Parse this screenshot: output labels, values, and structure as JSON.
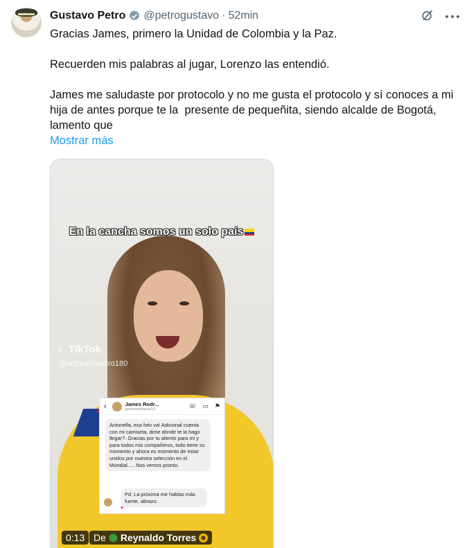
{
  "tweet": {
    "author_name": "Gustavo Petro",
    "handle": "@petrogustavo",
    "separator": "·",
    "time": "52min",
    "paragraphs": [
      "Gracias James, primero la Unidad de Colombia y la Paz.",
      "Recuerden mis palabras al jugar, Lorenzo las entendió.",
      "James me saludaste por protocolo y no me gusta el protocolo y sí conoces a mi hija de antes porque te la  presente de pequeñita, siendo alcalde de Bogotá, lamento que"
    ],
    "show_more": "Mostrar más"
  },
  "media": {
    "caption": "En la cancha somos un solo país",
    "watermark": "TikTok",
    "watermark_handle": "@antonellapetro180",
    "chat": {
      "name": "James Rodr...",
      "username": "jamesrodriguez10",
      "message": "Antonella, esa foto va! Adicional cuenta con mi camiseta, dime dónde te la hago llegar?. Gracias por tu aliento para mi y para todos mis compañeros, todo tiene su momento y ahora es momento de estar unidos por nuestra selección en el Mundial..... Nos vemos pronto.",
      "message_ps": "Pd: La próxima me hablas más fuerte, abrazo."
    },
    "duration": "0:13",
    "from_label": "De",
    "from_name": "Reynaldo Torres"
  },
  "colors": {
    "link": "#1d9bf0",
    "verified": "#829aab",
    "muted": "#536471"
  },
  "icons": {
    "verified": "verified-badge-icon",
    "grok": "grok-icon",
    "more": "more-icon"
  }
}
